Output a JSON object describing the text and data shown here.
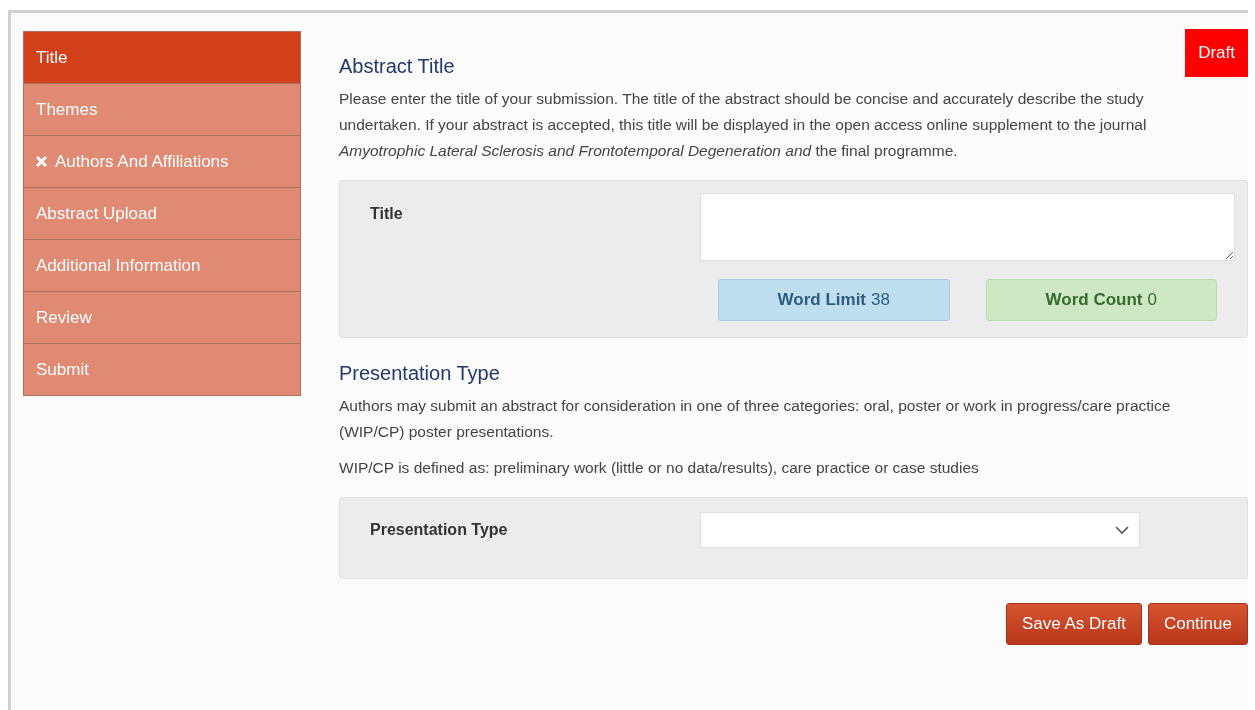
{
  "sidebar": {
    "items": [
      {
        "label": "Title",
        "selected": true,
        "invalid": false
      },
      {
        "label": "Themes",
        "selected": false,
        "invalid": false
      },
      {
        "label": "Authors And Affiliations",
        "selected": false,
        "invalid": true
      },
      {
        "label": "Abstract Upload",
        "selected": false,
        "invalid": false
      },
      {
        "label": "Additional Information",
        "selected": false,
        "invalid": false
      },
      {
        "label": "Review",
        "selected": false,
        "invalid": false
      },
      {
        "label": "Submit",
        "selected": false,
        "invalid": false
      }
    ]
  },
  "status_badge": "Draft",
  "abstract_title": {
    "heading": "Abstract Title",
    "description": "Please enter the title of your submission. The title of the abstract should be concise and accurately describe the study undertaken. If your abstract is accepted, this title will be displayed in the open access online supplement to the journal *Amyotrophic Lateral Sclerosis and Frontotemporal Degeneration and* the final programme.",
    "field_label": "Title",
    "word_limit": {
      "label": "Word Limit",
      "value": "38"
    },
    "word_count": {
      "label": "Word Count",
      "value": "0"
    }
  },
  "presentation_type": {
    "heading": "Presentation Type",
    "paragraphs": [
      "Authors may submit an abstract for consideration in one of three categories: oral, poster or work in progress/care practice (WIP/CP) poster presentations.",
      "WIP/CP is defined as: preliminary work (little or no data/results), care practice or case studies"
    ],
    "field_label": "Presentation Type"
  },
  "buttons": [
    "Save As Draft",
    "Continue"
  ]
}
